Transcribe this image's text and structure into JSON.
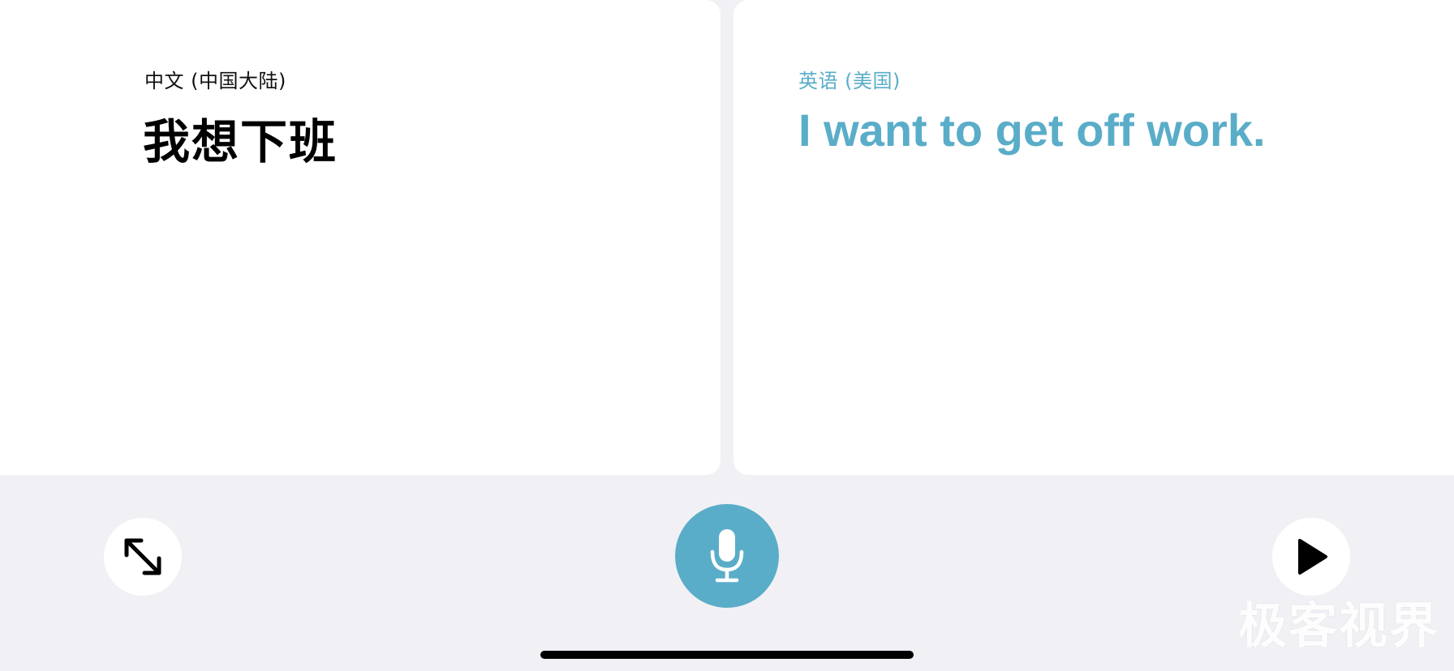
{
  "source_panel": {
    "language": "中文 (中国大陆)",
    "phrase": "我想下班"
  },
  "target_panel": {
    "language": "英语 (美国)",
    "phrase": "I want to get off work."
  },
  "controls": {
    "expand_icon": "expand-arrows-icon",
    "mic_icon": "microphone-icon",
    "play_icon": "play-icon"
  },
  "watermark": "极客视界",
  "colors": {
    "accent": "#5aadc8",
    "background": "#f1f1f5",
    "panel": "#ffffff"
  }
}
